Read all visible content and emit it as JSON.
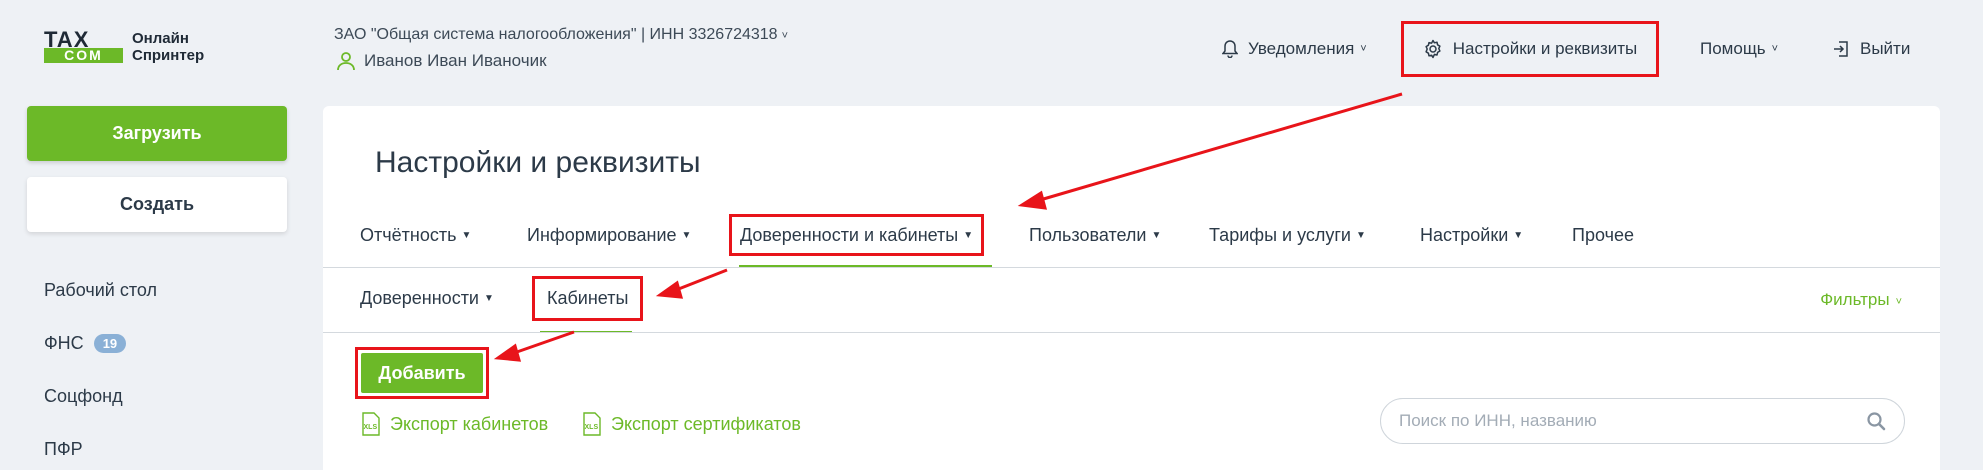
{
  "logo": {
    "mark_top": "TAX",
    "mark_bottom": "COM",
    "line1": "Онлайн",
    "line2": "Спринтер"
  },
  "header": {
    "org": "ЗАО \"Общая система налогообложения\" | ИНН 3326724318",
    "user": "Иванов Иван Иваночик",
    "notifications": "Уведомления",
    "settings": "Настройки и реквизиты",
    "help": "Помощь",
    "exit": "Выйти"
  },
  "sidebar": {
    "upload": "Загрузить",
    "create": "Создать",
    "items": [
      {
        "label": "Рабочий стол"
      },
      {
        "label": "ФНС",
        "badge": "19"
      },
      {
        "label": "Соцфонд"
      },
      {
        "label": "ПФР"
      }
    ]
  },
  "main": {
    "title": "Настройки и реквизиты",
    "tabs": [
      {
        "label": "Отчётность"
      },
      {
        "label": "Информирование"
      },
      {
        "label": "Доверенности и кабинеты"
      },
      {
        "label": "Пользователи"
      },
      {
        "label": "Тарифы и услуги"
      },
      {
        "label": "Настройки"
      },
      {
        "label": "Прочее"
      }
    ],
    "subtabs": [
      {
        "label": "Доверенности"
      },
      {
        "label": "Кабинеты"
      }
    ],
    "filters": "Фильтры",
    "add_button": "Добавить",
    "export_cabinets": "Экспорт кабинетов",
    "export_certs": "Экспорт сертификатов",
    "search_placeholder": "Поиск по ИНН, названию"
  },
  "colors": {
    "accent": "#6cb928",
    "highlight": "#e8141a",
    "text": "#2c3a48",
    "badge": "#8ab0d6"
  }
}
